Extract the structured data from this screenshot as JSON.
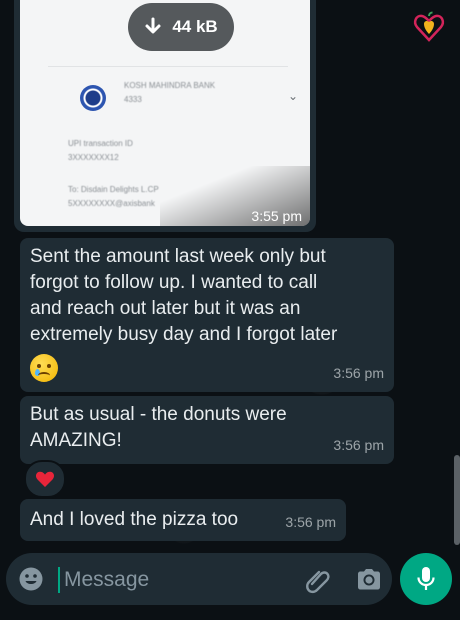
{
  "image_message": {
    "download_size": "44 kB",
    "time": "3:55 pm",
    "receipt": {
      "bank_name_line1": "KOSH MAHINDRA BANK",
      "bank_name_line2": "4333",
      "upi_label": "UPI transaction ID",
      "upi_value": "3XXXXXXX12",
      "to_label": "To: Disdain Delights L.CP",
      "to_value": "5XXXXXXXX@axisbank"
    }
  },
  "messages": [
    {
      "text": "Sent the amount last week only but\nforgot to follow up. I wanted to call\nand reach out later but it was an\nextremely busy day and I forgot later",
      "emoji": "face-holding-back-tears",
      "time": "3:56 pm"
    },
    {
      "text": "But as usual - the donuts were\nAMAZING!",
      "time": "3:56 pm",
      "reaction": "red-heart"
    },
    {
      "text": "And I loved the pizza too",
      "time": "3:56 pm"
    }
  ],
  "composer": {
    "placeholder": "Message"
  },
  "icons": {
    "download": "download-arrow-icon",
    "emoji": "emoji-icon",
    "attach": "paperclip-icon",
    "camera": "camera-icon",
    "mic": "microphone-icon",
    "logo": "heart-apple-logo"
  },
  "colors": {
    "background": "#0b1014",
    "bubble": "#1f2c34",
    "accent": "#00a884",
    "text": "#e9edef",
    "meta": "#8696a0"
  }
}
